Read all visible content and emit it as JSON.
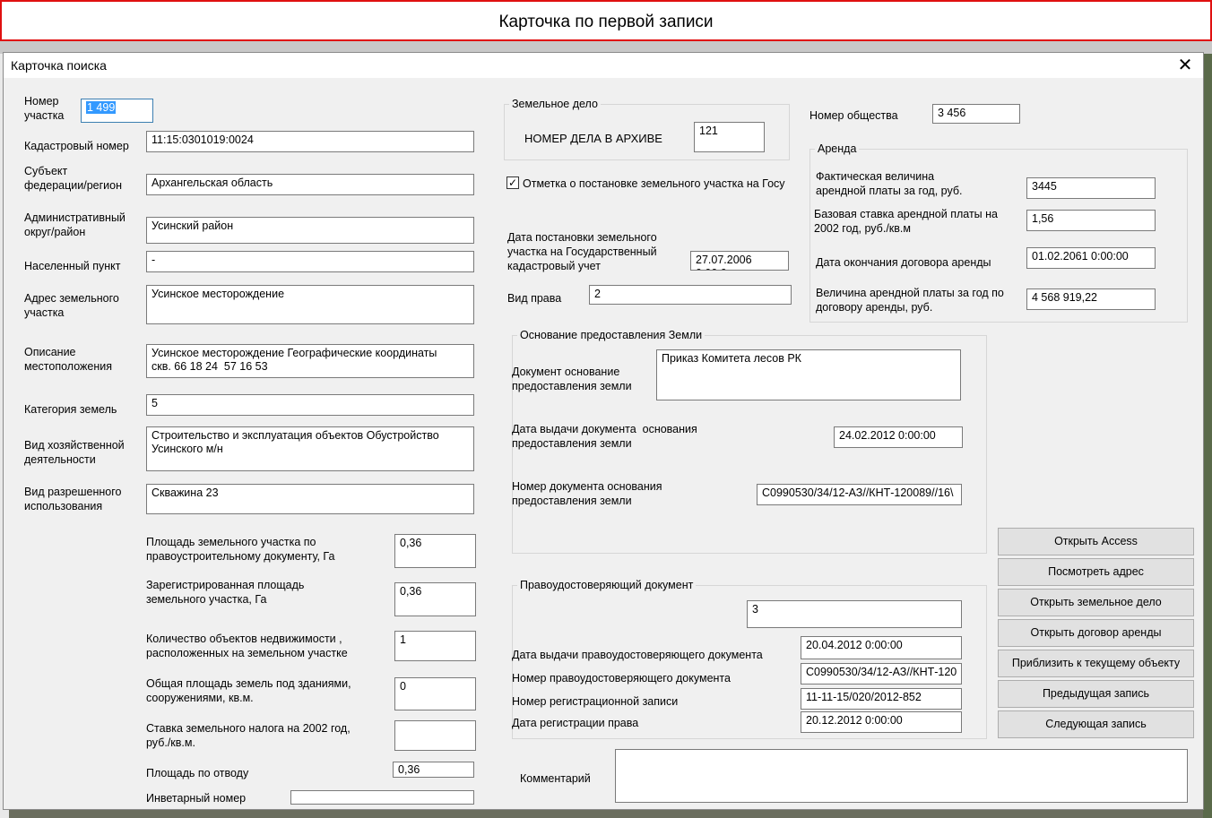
{
  "banner": {
    "title": "Карточка по первой записи"
  },
  "window": {
    "title": "Карточка поиска",
    "close": "✕"
  },
  "left": {
    "parcel_number_label": "Номер\nучастка",
    "parcel_number": "1 499",
    "cadastral_label": "Кадастровый номер",
    "cadastral": "11:15:0301019:0024",
    "subject_label": "Субъект\nфедерации/регион",
    "subject": "Архангельская область",
    "district_label": "Административный\nокруг/район",
    "district": "Усинский район",
    "locality_label": "Населенный пункт",
    "locality": "-",
    "address_label": "Адрес земельного\nучастка",
    "address": "Усинское месторождение",
    "location_label": "Описание\nместоположения",
    "location": "Усинское месторождение Географические координаты\nскв. 66 18 24  57 16 53",
    "category_label": "Категория земель",
    "category": "5",
    "activity_label": "Вид хозяйственной\nдеятельности",
    "activity": "Строительство и эксплуатация объектов Обустройство\nУсинского м/н",
    "permitted_label": "Вид разрешенного\nиспользования",
    "permitted": "Скважина 23",
    "area_doc_label": "Площадь земельного участка по\nправоустроительному документу, Га",
    "area_doc": "0,36",
    "area_reg_label": "Зарегистрированная площадь\nземельного участка, Га",
    "area_reg": "0,36",
    "objects_label": "Количество объектов недвижимости ,\nрасположенных на земельном участке",
    "objects": "1",
    "buildings_label": "Общая площадь земель под зданиями,\nсооружениями, кв.м.",
    "buildings": "0",
    "tax_label": "Ставка земельного налога на 2002 год,\nруб./кв.м.",
    "tax": "",
    "allot_label": "Площадь по отводу",
    "allot": "0,36",
    "inventory_label": "Инветарный номер",
    "inventory": ""
  },
  "land_case": {
    "group_title": "Земельное дело",
    "archive_label": "НОМЕР ДЕЛА В АРХИВЕ",
    "archive": "121"
  },
  "registration": {
    "checkbox_label": "Отметка о постановке земельного участка на Госу",
    "checked": "✓",
    "date_label": "Дата постановки земельного\nучастка на Государственный\nкадастровый учет",
    "date": "27.07.2006 0:00:0",
    "right_label": "Вид права",
    "right": "2"
  },
  "society": {
    "label": "Номер общества",
    "value": "3 456"
  },
  "rent": {
    "group_title": "Аренда",
    "actual_label": "Фактическая величина\nарендной платы за год, руб.",
    "actual": "3445",
    "base_label": "Базовая ставка арендной платы на\n2002 год, руб./кв.м",
    "base": "1,56",
    "end_label": "Дата окончания договора аренды",
    "end": "01.02.2061 0:00:00",
    "contract_label": "Величина арендной платы за год по\nдоговору аренды, руб.",
    "contract": "4 568 919,22"
  },
  "basis": {
    "group_title": "Основание предоставления Земли",
    "doc_label": "Документ основание\nпредоставления земли",
    "doc": "Приказ Комитета лесов РК",
    "date_label": "Дата выдачи документа  основания\nпредоставления земли",
    "date": "24.02.2012 0:00:00",
    "num_label": "Номер документа основания\nпредоставления земли",
    "num": "С0990530/34/12-АЗ//КНТ-120089//16\\"
  },
  "title_doc": {
    "group_title": "Правоудостоверяющий документ",
    "value": "3",
    "issue_label": "Дата выдачи правоудостоверяющего документа",
    "issue": "20.04.2012 0:00:00",
    "num_label": "Номер правоудостоверяющего документа",
    "num": "С0990530/34/12-АЗ//КНТ-120",
    "reg_label": "Номер регистрационной записи",
    "reg": "11-11-15/020/2012-852",
    "reg_date_label": "Дата регистрации права",
    "reg_date": "20.12.2012 0:00:00"
  },
  "comment": {
    "label": "Комментарий",
    "value": ""
  },
  "buttons": {
    "access": "Открыть Access",
    "address": "Посмотреть адрес",
    "land_case": "Открыть земельное дело",
    "rent": "Открыть договор аренды",
    "zoom": "Приблизить к текущему объекту",
    "prev": "Предыдущая запись",
    "next": "Следующая запись"
  }
}
